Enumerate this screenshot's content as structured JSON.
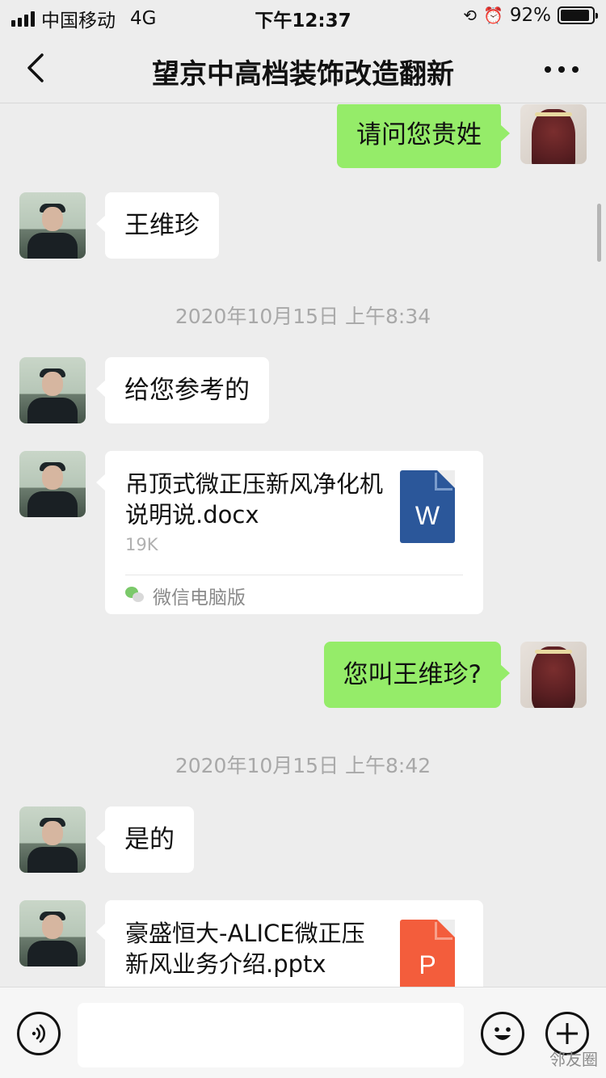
{
  "status_bar": {
    "carrier": "中国移动",
    "network": "4G",
    "time": "下午12:37",
    "battery_percent": "92%",
    "battery_level": 0.92
  },
  "nav": {
    "title": "望京中高档装饰改造翻新"
  },
  "messages": [
    {
      "side": "out",
      "text": "请问您贵姓"
    },
    {
      "side": "in",
      "text": "王维珍"
    },
    {
      "timestamp": "2020年10月15日 上午8:34"
    },
    {
      "side": "in",
      "text": "给您参考的"
    },
    {
      "side": "in",
      "file": {
        "name": "吊顶式微正压新风净化机说明说.docx",
        "size": "19K",
        "type": "word",
        "icon_letter": "W",
        "source": "微信电脑版"
      }
    },
    {
      "side": "out",
      "text": "您叫王维珍?"
    },
    {
      "timestamp": "2020年10月15日 上午8:42"
    },
    {
      "side": "in",
      "text": "是的"
    },
    {
      "side": "in",
      "file": {
        "name": "豪盛恒大-ALICE微正压新风业务介绍.pptx",
        "type": "ppt",
        "icon_letter": "P"
      }
    }
  ],
  "input_bar": {
    "voice_icon": "voice-icon",
    "emoji_icon": "emoji-icon",
    "plus_icon": "plus-icon",
    "input_value": ""
  },
  "watermark": "邻友圈"
}
